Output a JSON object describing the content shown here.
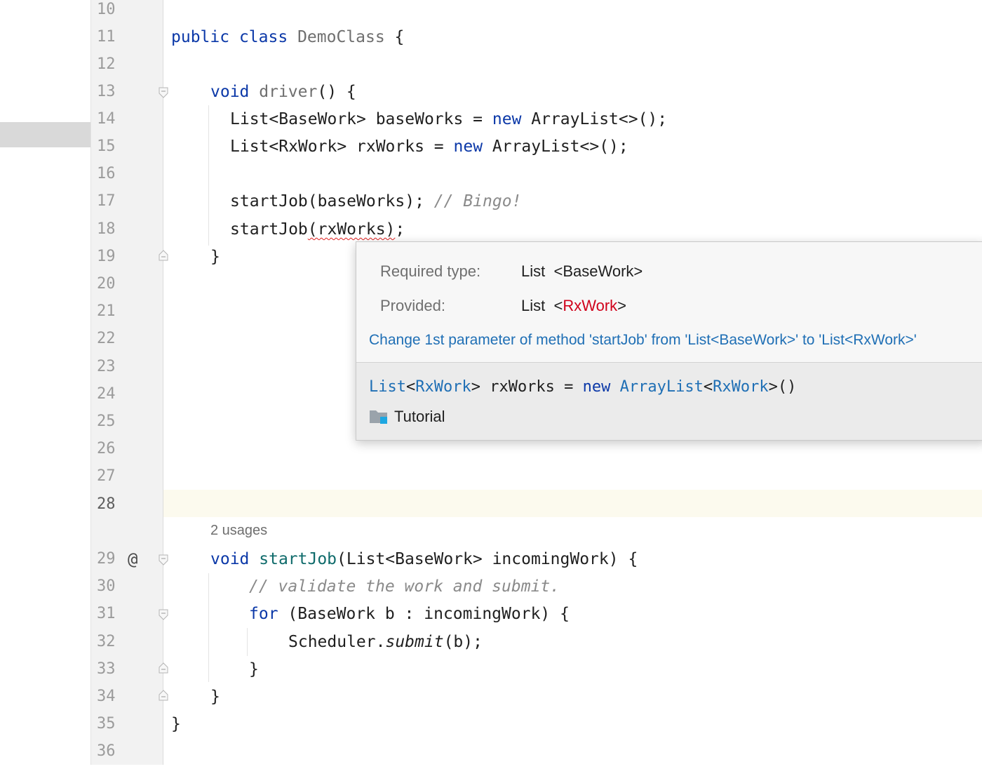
{
  "line_numbers": [
    "10",
    "11",
    "12",
    "13",
    "14",
    "15",
    "16",
    "17",
    "18",
    "19",
    "20",
    "21",
    "22",
    "23",
    "24",
    "25",
    "26",
    "27",
    "28",
    "29",
    "30",
    "31",
    "32",
    "33",
    "34",
    "35",
    "36"
  ],
  "current_line": "28",
  "code": {
    "l11_kw1": "public",
    "l11_kw2": "class",
    "l11_name": "DemoClass",
    "l11_brace": " {",
    "l13_kw": "void",
    "l13_fn": "driver",
    "l13_rest": "() {",
    "l14_a": "List<BaseWork> baseWorks = ",
    "l14_kw": "new",
    "l14_b": " ArrayList<>();",
    "l15_a": "List<RxWork> rxWorks = ",
    "l15_kw": "new",
    "l15_b": " ArrayList<>();",
    "l17_a": "startJob(baseWorks); ",
    "l17_cmt": "// Bingo!",
    "l18_a": "startJob",
    "l18_err": "(rxWorks)",
    "l18_b": ";",
    "l19": "}",
    "usages": "2 usages",
    "l29_kw": "void",
    "l29_fn": "startJob",
    "l29_rest": "(List<BaseWork> incomingWork) {",
    "l30_cmt": "// validate the work and submit.",
    "l31_kw": "for",
    "l31_rest": " (BaseWork b : incomingWork) {",
    "l32_a": "Scheduler.",
    "l32_it": "submit",
    "l32_b": "(b);",
    "l33": "}",
    "l34": "}",
    "l35": "}"
  },
  "popup": {
    "required_label": "Required type:",
    "required_type": "List",
    "required_generic": "<BaseWork>",
    "provided_label": "Provided:",
    "provided_type": "List",
    "provided_lt": "<",
    "provided_generic": "RxWork",
    "provided_gt": ">",
    "quick_fix": "Change 1st parameter of method 'startJob' from 'List<BaseWork>' to 'List<RxWork>'",
    "decl_t1": "List",
    "decl_p1": "<",
    "decl_t2": "RxWork",
    "decl_p2": "> rxWorks = ",
    "decl_kw": "new",
    "decl_sp": " ",
    "decl_t3": "ArrayList",
    "decl_p3": "<",
    "decl_t4": "RxWork",
    "decl_p4": ">()",
    "project_name": "Tutorial",
    "project_icon": "folder-icon"
  },
  "colors": {
    "keyword": "#0b38a8",
    "error": "#d0021b",
    "link": "#1f6fb5",
    "comment": "#8a8a8a"
  }
}
